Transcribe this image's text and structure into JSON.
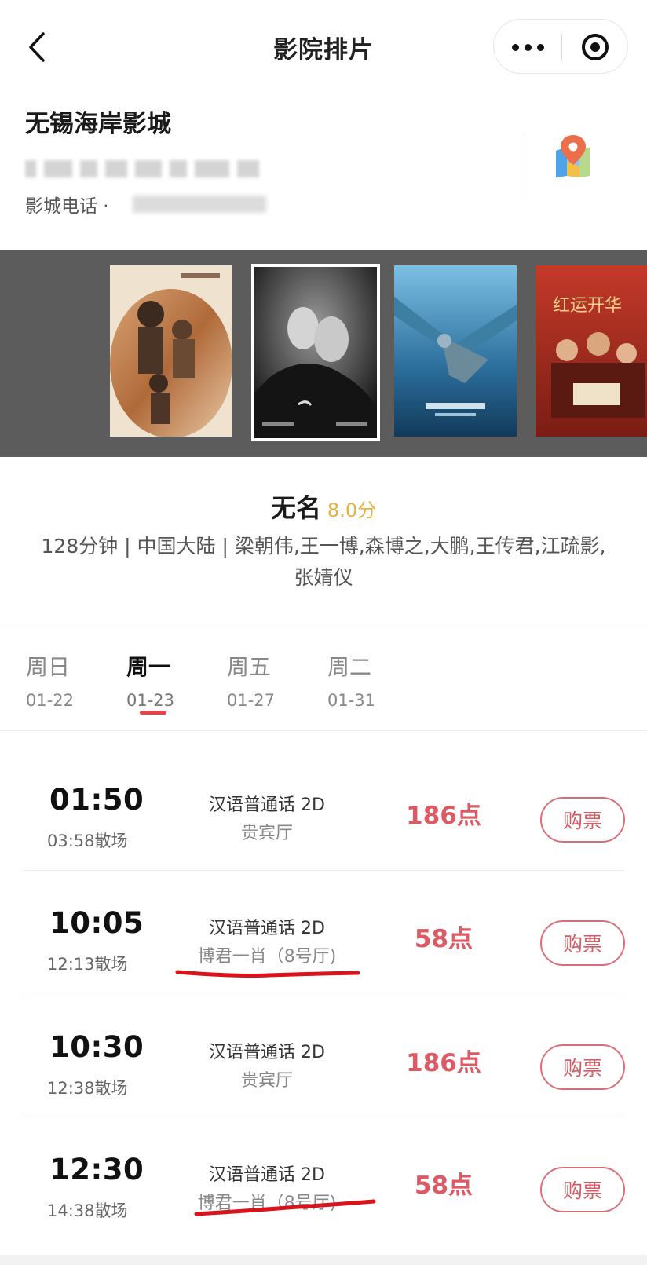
{
  "header": {
    "title": "影院排片",
    "back_icon": "chevron-left-icon",
    "more_icon": "more-dots-icon",
    "close_icon": "target-circle-icon"
  },
  "cinema": {
    "name": "无锡海岸影城",
    "phone_label": "影城电话 ·",
    "map_icon": "map-pin-icon"
  },
  "posters": [
    {
      "name": "poster-1",
      "selected": false
    },
    {
      "name": "poster-2",
      "selected": true
    },
    {
      "name": "poster-3",
      "selected": false
    },
    {
      "name": "poster-4",
      "selected": false,
      "text": "红运开华"
    }
  ],
  "movie": {
    "name": "无名",
    "score": "8.0分",
    "meta": "128分钟 | 中国大陆 | 梁朝伟,王一博,森博之,大鹏,王传君,江疏影,张婧仪"
  },
  "dates": [
    {
      "dow": "周日",
      "date": "01-22",
      "active": false
    },
    {
      "dow": "周一",
      "date": "01-23",
      "active": true
    },
    {
      "dow": "周五",
      "date": "01-27",
      "active": false
    },
    {
      "dow": "周二",
      "date": "01-31",
      "active": false
    }
  ],
  "showtimes": [
    {
      "start": "01:50",
      "end": "03:58散场",
      "lang": "汉语普通话 2D",
      "hall": "贵宾厅",
      "price": "186点",
      "buy": "购票"
    },
    {
      "start": "10:05",
      "end": "12:13散场",
      "lang": "汉语普通话 2D",
      "hall": "博君一肖（8号厅)",
      "price": "58点",
      "buy": "购票"
    },
    {
      "start": "10:30",
      "end": "12:38散场",
      "lang": "汉语普通话 2D",
      "hall": "贵宾厅",
      "price": "186点",
      "buy": "购票"
    },
    {
      "start": "12:30",
      "end": "14:38散场",
      "lang": "汉语普通话 2D",
      "hall": "博君一肖（8号厅)",
      "price": "58点",
      "buy": "购票"
    }
  ],
  "colors": {
    "accent": "#dd5a64",
    "score": "#e8b33a",
    "annotation": "#d8131b",
    "strip_bg": "#5c5c5c"
  }
}
